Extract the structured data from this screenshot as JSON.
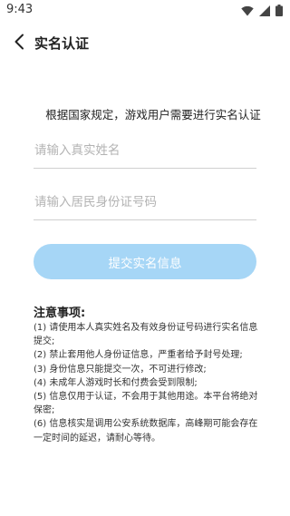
{
  "status_bar": {
    "time": "9:43",
    "icons": [
      "wifi-icon",
      "signal-icon",
      "battery-icon"
    ]
  },
  "nav": {
    "title": "实名认证",
    "back_icon": "chevron-left-icon"
  },
  "form": {
    "notice": "根据国家规定，游戏用户需要进行实名认证",
    "name_placeholder": "请输入真实姓名",
    "name_value": "",
    "id_placeholder": "请输入居民身份证号码",
    "id_value": "",
    "submit_label": "提交实名信息"
  },
  "notes": {
    "title": "注意事项:",
    "items": [
      "(1) 请使用本人真实姓名及有效身份证号码进行实名信息提交;",
      "(2) 禁止套用他人身份证信息，严重者给予封号处理;",
      "(3) 身份信息只能提交一次，不可进行修改;",
      "(4) 未成年人游戏时长和付费会受到限制;",
      "(5) 信息仅用于认证，不会用于其他用途。本平台将绝对保密;",
      "(6) 信息核实是调用公安系统数据库，高峰期可能会存在一定时间的延迟，请耐心等待。"
    ]
  },
  "colors": {
    "button_bg": "#a6d6f6",
    "button_text": "#ffffff",
    "divider": "#cfcfcf",
    "placeholder": "#b3b3b3"
  }
}
